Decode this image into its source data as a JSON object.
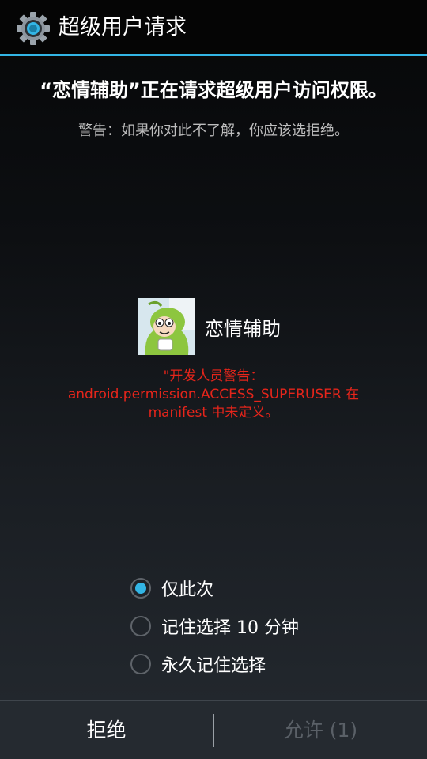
{
  "titlebar": {
    "icon": "gear-icon",
    "title": "超级用户请求"
  },
  "request": {
    "message": "“恋情辅助”正在请求超级用户访问权限。",
    "warning": "警告：如果你对此不了解，你应该选拒绝。"
  },
  "app": {
    "name": "恋情辅助",
    "avatar_icon": "app-avatar-icon"
  },
  "developer_warning": {
    "line1": "\"开发人员警告：",
    "line2": "android.permission.ACCESS_SUPERUSER 在",
    "line3": "manifest 中未定义。"
  },
  "options": [
    {
      "label": "仅此次",
      "checked": true
    },
    {
      "label": "记住选择 10 分钟",
      "checked": false
    },
    {
      "label": "永久记住选择",
      "checked": false
    }
  ],
  "buttons": {
    "deny": "拒绝",
    "allow": "允许 (1)"
  },
  "colors": {
    "accent": "#33b5e5",
    "warning_red": "#e5251b",
    "disabled_text": "#5a6067"
  }
}
